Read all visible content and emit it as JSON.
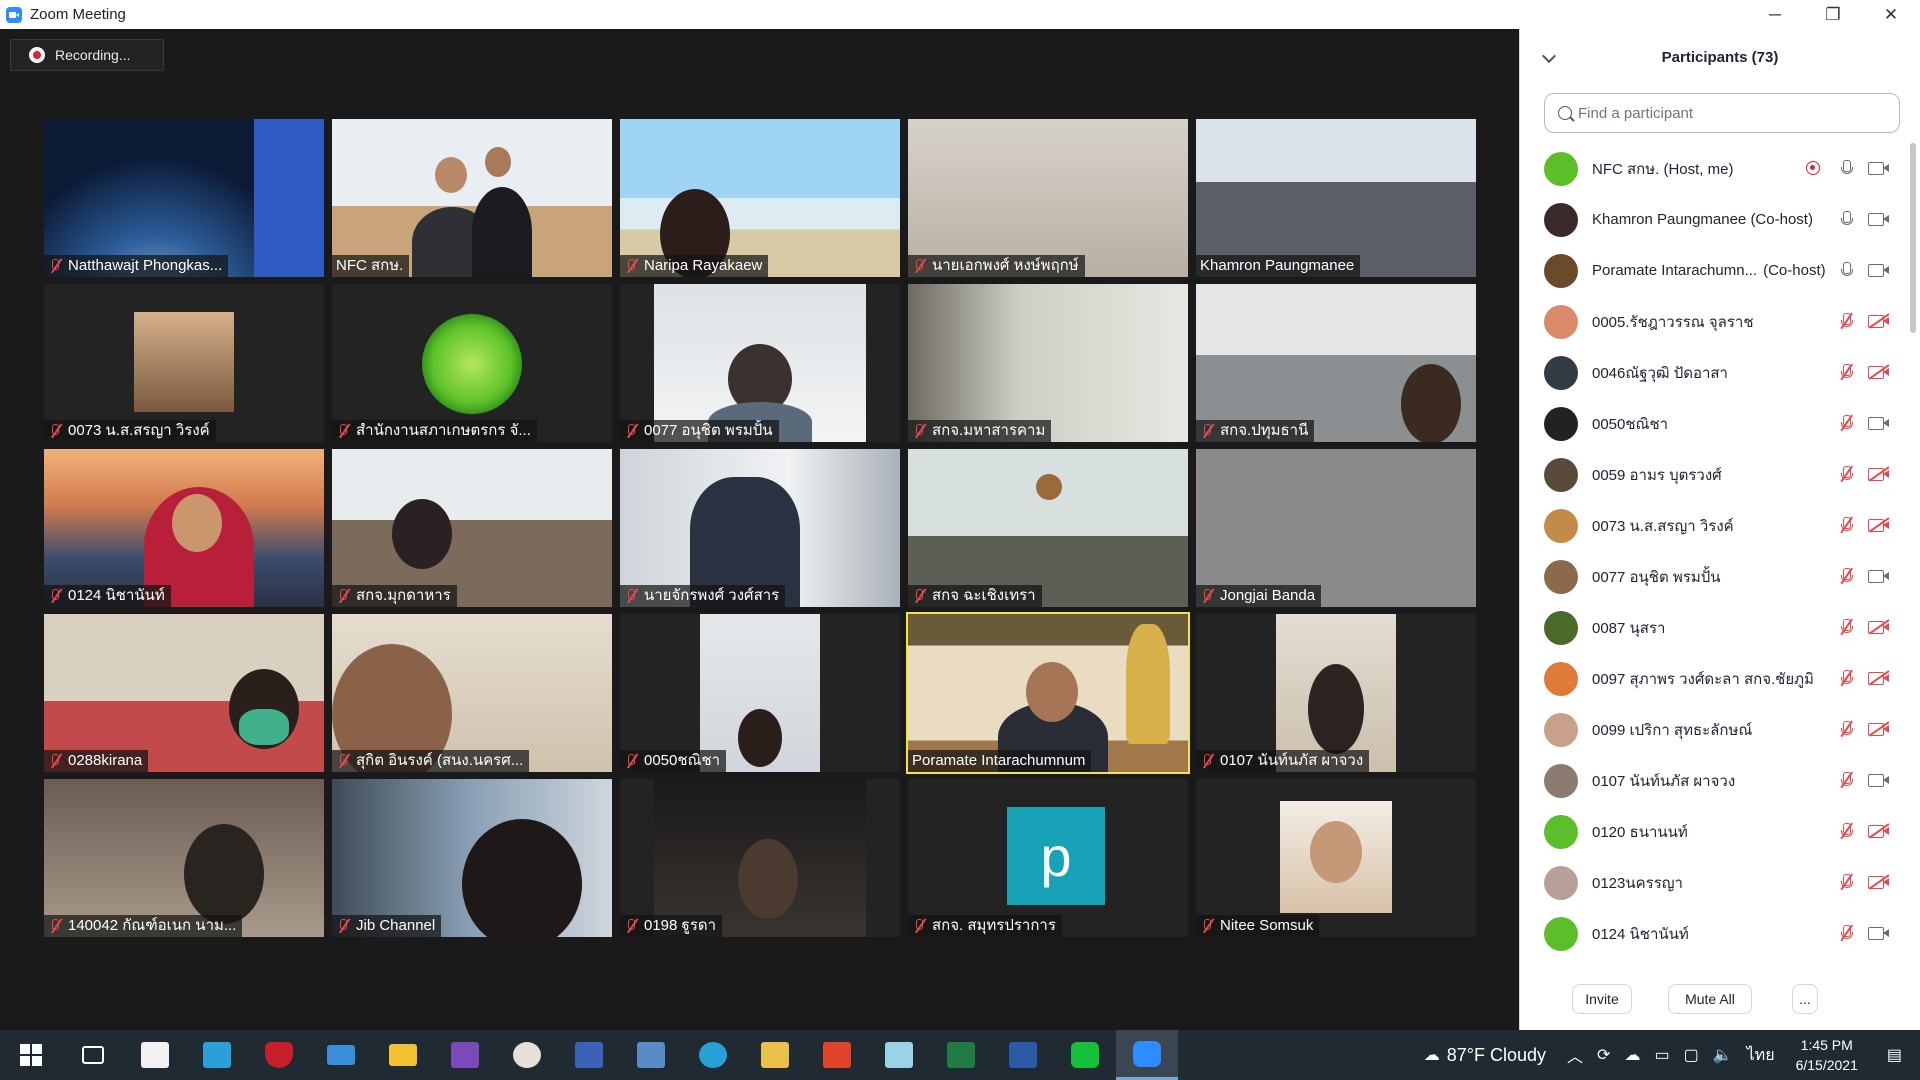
{
  "window": {
    "title": "Zoom Meeting",
    "controls": {
      "minimize": "─",
      "maximize": "❐",
      "close": "✕"
    }
  },
  "recording": {
    "label": "Recording..."
  },
  "tiles": [
    {
      "name": "Natthawajt Phongkas...",
      "muted": true
    },
    {
      "name": "NFC สกษ.",
      "muted": false
    },
    {
      "name": "Naripa Rayakaew",
      "muted": true
    },
    {
      "name": "นายเอกพงศ์ หงษ์พฤกษ์",
      "muted": true
    },
    {
      "name": "Khamron Paungmanee",
      "muted": false
    },
    {
      "name": "0073 น.ส.สรญา  วิรงค์",
      "muted": true
    },
    {
      "name": "สำนักงานสภาเกษตรกร จั...",
      "muted": true
    },
    {
      "name": "0077 อนุชิต พรมปั้น",
      "muted": true
    },
    {
      "name": "สกจ.มหาสารคาม",
      "muted": true
    },
    {
      "name": "สกจ.ปทุมธานี",
      "muted": true
    },
    {
      "name": "0124 นิชานันท์",
      "muted": true
    },
    {
      "name": "สกจ.มุกดาหาร",
      "muted": true
    },
    {
      "name": "นายจักรพงศ์ วงศ์สาร",
      "muted": true
    },
    {
      "name": "สกจ ฉะเชิงเทรา",
      "muted": true
    },
    {
      "name": "Jongjai Banda",
      "muted": true
    },
    {
      "name": "0288kirana",
      "muted": true
    },
    {
      "name": "สุกิต  อินรงค์ (สนง.นครศ...",
      "muted": true
    },
    {
      "name": "0050ชณิชา",
      "muted": true
    },
    {
      "name": "Poramate Intarachumnum",
      "muted": false
    },
    {
      "name": "0107 นันท์นภัส  ผาจวง",
      "muted": true
    },
    {
      "name": "140042 กัณฑ์อเนก นาม...",
      "muted": true
    },
    {
      "name": "Jib Channel",
      "muted": true
    },
    {
      "name": "0198 ฐูรดา",
      "muted": true
    },
    {
      "name": "สกจ. สมุทรปราการ",
      "muted": true
    },
    {
      "name": "Nitee Somsuk",
      "muted": true
    }
  ],
  "avatar_letter": "p",
  "participants_panel": {
    "title": "Participants (73)",
    "search_placeholder": "Find a participant",
    "participants": [
      {
        "name": "NFC สกษ. (Host, me)",
        "role": "",
        "mic": "on",
        "cam": "on",
        "recording": true,
        "avatar_color": "#5cbf2a"
      },
      {
        "name": "Khamron Paungmanee (Co-host)",
        "role": "",
        "mic": "on",
        "cam": "on",
        "recording": false,
        "avatar_color": "#3b2a2a"
      },
      {
        "name": "Poramate Intarachumn...",
        "role": "(Co-host)",
        "mic": "on",
        "cam": "on",
        "recording": false,
        "avatar_color": "#6b4a2a"
      },
      {
        "name": "0005.รัชฎาวรรณ จุลราช",
        "role": "",
        "mic": "off",
        "cam": "off",
        "recording": false,
        "avatar_color": "#d98a6a"
      },
      {
        "name": "0046ณัฐวุฒิ ปัดอาสา",
        "role": "",
        "mic": "off",
        "cam": "off",
        "recording": false,
        "avatar_color": "#333b45"
      },
      {
        "name": "0050ชณิชา",
        "role": "",
        "mic": "off",
        "cam": "on",
        "recording": false,
        "avatar_color": "#222222"
      },
      {
        "name": "0059 อามร บุตรวงศ์",
        "role": "",
        "mic": "off",
        "cam": "off",
        "recording": false,
        "avatar_color": "#5a4a3a"
      },
      {
        "name": "0073 น.ส.สรญา  วิรงค์",
        "role": "",
        "mic": "off",
        "cam": "off",
        "recording": false,
        "avatar_color": "#c48a4a"
      },
      {
        "name": "0077 อนุชิต พรมปั้น",
        "role": "",
        "mic": "off",
        "cam": "on",
        "recording": false,
        "avatar_color": "#8a6a4a"
      },
      {
        "name": "0087 นุสรา",
        "role": "",
        "mic": "off",
        "cam": "off",
        "recording": false,
        "avatar_color": "#4a6a2a"
      },
      {
        "name": "0097 สุภาพร วงศ์ดะลา สกจ.ชัยภูมิ",
        "role": "",
        "mic": "off",
        "cam": "off",
        "recording": false,
        "avatar_color": "#e07a3a"
      },
      {
        "name": "0099 เปริกา สุทธะลักษณ์",
        "role": "",
        "mic": "off",
        "cam": "off",
        "recording": false,
        "avatar_color": "#c9a08a"
      },
      {
        "name": "0107 นันท์นภัส  ผาจวง",
        "role": "",
        "mic": "off",
        "cam": "on",
        "recording": false,
        "avatar_color": "#8a7a70"
      },
      {
        "name": "0120 ธนานนท์",
        "role": "",
        "mic": "off",
        "cam": "off",
        "recording": false,
        "avatar_color": "#5cbf2a"
      },
      {
        "name": "0123นครรญา",
        "role": "",
        "mic": "off",
        "cam": "off",
        "recording": false,
        "avatar_color": "#b8a09a"
      },
      {
        "name": "0124 นิชานันท์",
        "role": "",
        "mic": "off",
        "cam": "on",
        "recording": false,
        "avatar_color": "#5cbf2a"
      }
    ],
    "footer": {
      "invite": "Invite",
      "mute_all": "Mute All",
      "more": "..."
    }
  },
  "taskbar": {
    "weather": "87°F  Cloudy",
    "language": "ไทย",
    "time": "1:45 PM",
    "date": "6/15/2021"
  }
}
